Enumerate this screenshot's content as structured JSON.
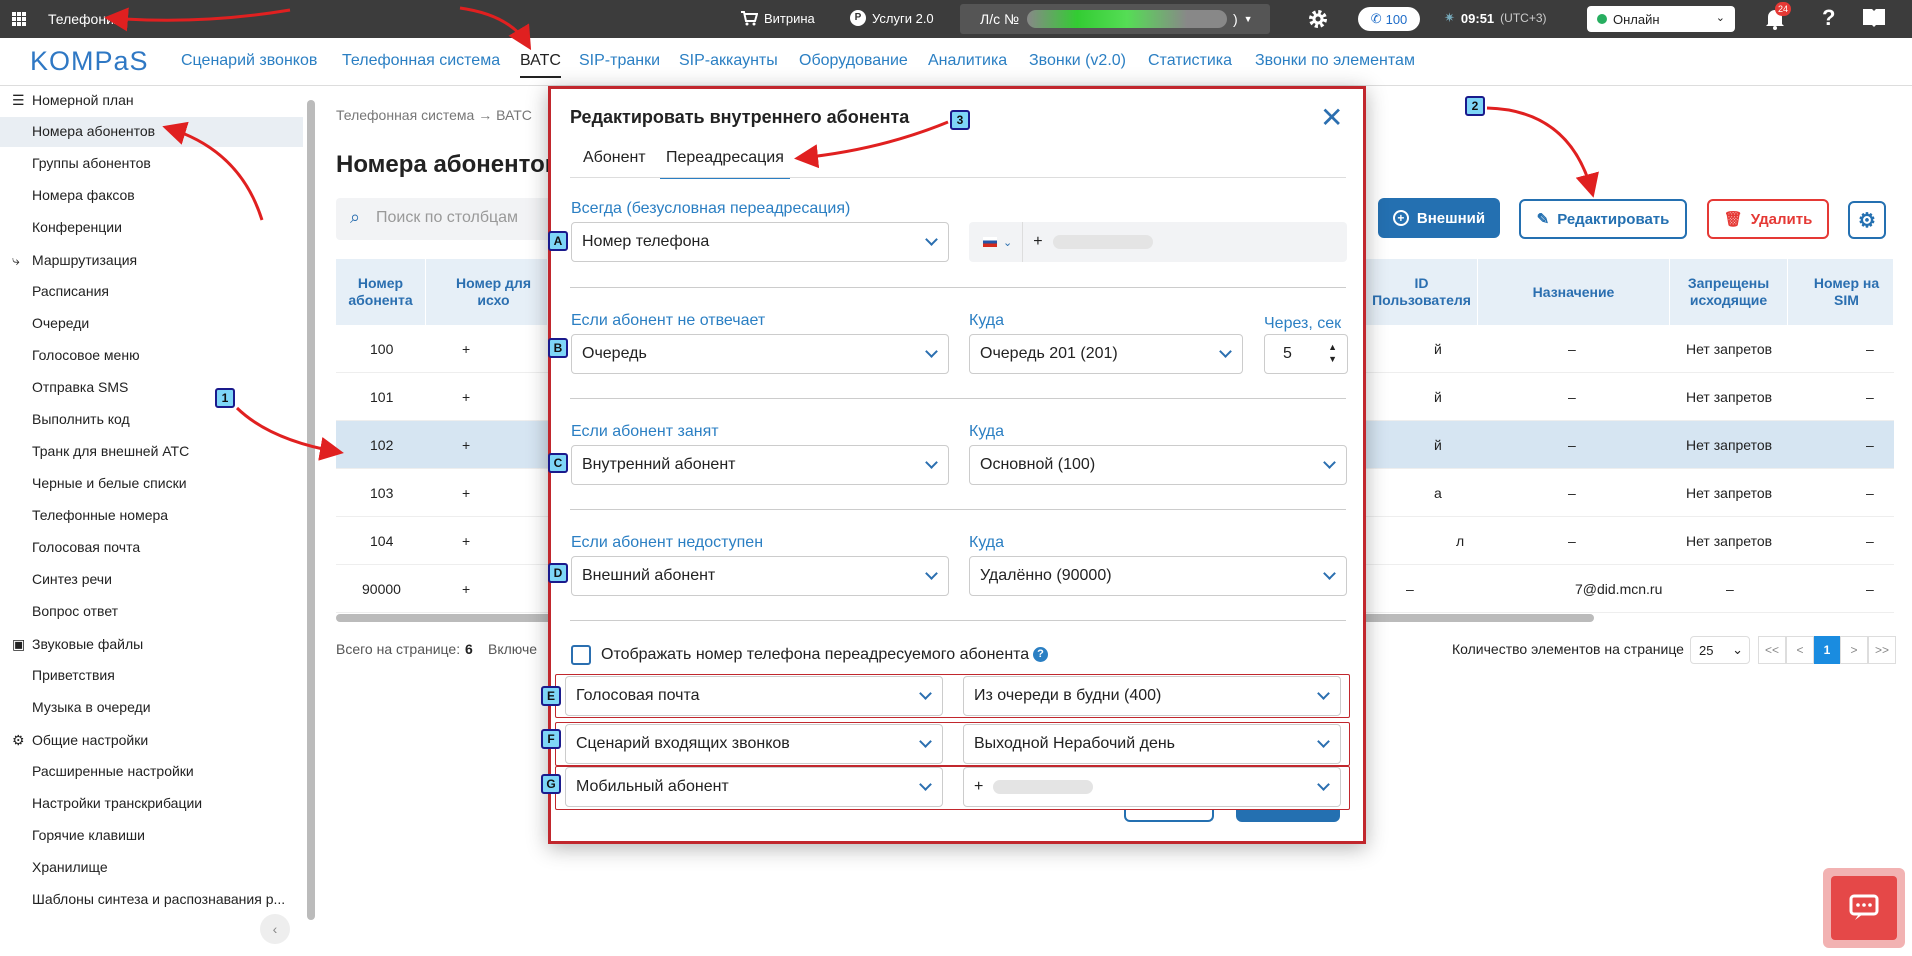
{
  "topbar": {
    "title": "Телефония",
    "showcase": "Витрина",
    "services": "Услуги 2.0",
    "account": "Л/с №",
    "account_suffix": ")",
    "calls_count": "100",
    "time": "09:51",
    "timezone": "(UTC+3)",
    "status": "Онлайн",
    "notif_count": "24"
  },
  "nav": {
    "logo": "KOMPaS",
    "tabs": [
      "Сценарий звонков",
      "Телефонная система",
      "ВАТС",
      "SIP-транки",
      "SIP-аккаунты",
      "Оборудование",
      "Аналитика",
      "Звонки (v2.0)",
      "Статистика",
      "Звонки по элементам"
    ]
  },
  "sidebar": {
    "sections": {
      "numbering": "Номерной план",
      "routing": "Маршрутизация",
      "sounds": "Звуковые файлы",
      "settings": "Общие настройки"
    },
    "items": [
      "Номера абонентов",
      "Группы абонентов",
      "Номера факсов",
      "Конференции",
      "Расписания",
      "Очереди",
      "Голосовое меню",
      "Отправка SMS",
      "Выполнить код",
      "Транк для внешней АТС",
      "Черные и белые списки",
      "Телефонные номера",
      "Голосовая почта",
      "Синтез речи",
      "Вопрос ответ",
      "Приветствия",
      "Музыка в очереди",
      "Расширенные настройки",
      "Настройки транскрибации",
      "Горячие клавиши",
      "Хранилище",
      "Шаблоны синтеза и распознавания р..."
    ]
  },
  "page": {
    "crumb1": "Телефонная система",
    "crumb2": "ВАТС",
    "title": "Номера абонентов",
    "search_placeholder": "Поиск по столбцам",
    "btn_external": "Внешний",
    "btn_edit": "Редактировать",
    "btn_delete": "Удалить"
  },
  "table": {
    "headers": {
      "num": "Номер абонента",
      "out": "Номер для исхо",
      "uid": "ID Пользователя",
      "dest": "Назначение",
      "forbid": "Запрещены исходящие",
      "sim": "Номер на SIM"
    },
    "rows": [
      {
        "num": "100",
        "out": "+",
        "uid": "й",
        "dest": "–",
        "forbid": "Нет запретов",
        "sim": "–"
      },
      {
        "num": "101",
        "out": "+",
        "uid": "й",
        "dest": "–",
        "forbid": "Нет запретов",
        "sim": "–"
      },
      {
        "num": "102",
        "out": "+",
        "uid": "й",
        "dest": "–",
        "forbid": "Нет запретов",
        "sim": "–"
      },
      {
        "num": "103",
        "out": "+",
        "uid": "а",
        "dest": "–",
        "forbid": "Нет запретов",
        "sim": "–"
      },
      {
        "num": "104",
        "out": "+",
        "uid": "л",
        "dest": "–",
        "forbid": "Нет запретов",
        "sim": "–"
      },
      {
        "num": "90000",
        "out": "+",
        "uid": "–",
        "dest": "7@did.mcn.ru",
        "forbid": "–",
        "sim": "–"
      }
    ]
  },
  "footer": {
    "total_label": "Всего на странице:",
    "total": "6",
    "included": "Включе",
    "per_page_label": "Количество элементов на странице",
    "per_page": "25",
    "first": "<<",
    "prev": "<",
    "page": "1",
    "next": ">",
    "last": ">>"
  },
  "modal": {
    "title": "Редактировать внутреннего абонента",
    "tab_subscriber": "Абонент",
    "tab_forward": "Переадресация",
    "always_label": "Всегда (безусловная переадресация)",
    "always_value": "Номер телефона",
    "phone_prefix": "+",
    "noanswer_label": "Если абонент не отвечает",
    "noanswer_value": "Очередь",
    "where": "Куда",
    "noanswer_where": "Очередь 201 (201)",
    "after_label": "Через, сек",
    "after_value": "5",
    "busy_label": "Если абонент занят",
    "busy_value": "Внутренний абонент",
    "busy_where": "Основной (100)",
    "unavail_label": "Если абонент недоступен",
    "unavail_value": "Внешний абонент",
    "unavail_where": "Удалённо (90000)",
    "show_number_label": "Отображать номер телефона переадресуемого абонента",
    "opt_e": "Голосовая почта",
    "opt_e_where": "Из очереди в будни (400)",
    "opt_f": "Сценарий входящих звонков",
    "opt_f_where": "Выходной Нерабочий день",
    "opt_g": "Мобильный абонент",
    "opt_g_where": "+"
  },
  "markers": {
    "m1": "1",
    "m2": "2",
    "m3": "3",
    "mA": "A",
    "mB": "B",
    "mC": "C",
    "mD": "D",
    "mE": "E",
    "mF": "F",
    "mG": "G"
  },
  "colors": {
    "accent": "#2b7fc3",
    "primary_btn": "#2470b1",
    "danger": "#e53935",
    "annotation": "#c1272d",
    "marker_fill": "#7ed6f7",
    "online": "#27ae60"
  }
}
